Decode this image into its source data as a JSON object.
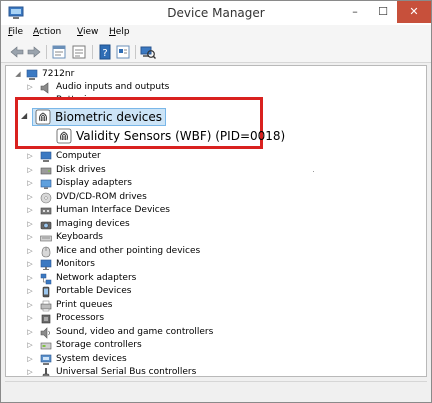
{
  "window": {
    "title": "Device Manager",
    "minimize": "–",
    "maximize": "☐",
    "close": "✕"
  },
  "menu": [
    {
      "label": "File",
      "accel": "F",
      "rest": "ile"
    },
    {
      "label": "Action",
      "accel": "A",
      "rest": "ction"
    },
    {
      "label": "View",
      "accel": "V",
      "rest": "iew"
    },
    {
      "label": "Help",
      "accel": "H",
      "rest": "elp"
    }
  ],
  "toolbar": [
    "back-icon",
    "forward-icon",
    "properties-icon",
    "show-hidden-icon",
    "help-icon",
    "action-icon",
    "scan-hardware-icon"
  ],
  "tree": {
    "root": "7212nr",
    "partial_top": [
      "Audio inputs and outputs",
      "Batteries"
    ],
    "highlight": {
      "parent": "Biometric devices",
      "child": "Validity Sensors (WBF) (PID=0018)"
    },
    "items": [
      "Computer",
      "Disk drives",
      "Display adapters",
      "DVD/CD-ROM drives",
      "Human Interface Devices",
      "Imaging devices",
      "Keyboards",
      "Mice and other pointing devices",
      "Monitors",
      "Network adapters",
      "Portable Devices",
      "Print queues",
      "Processors",
      "Sound, video and game controllers",
      "Storage controllers",
      "System devices",
      "Universal Serial Bus controllers"
    ]
  },
  "colors": {
    "highlight_border": "#d9211f",
    "selection_bg": "#cce4f7",
    "close_button": "#c7503b"
  }
}
